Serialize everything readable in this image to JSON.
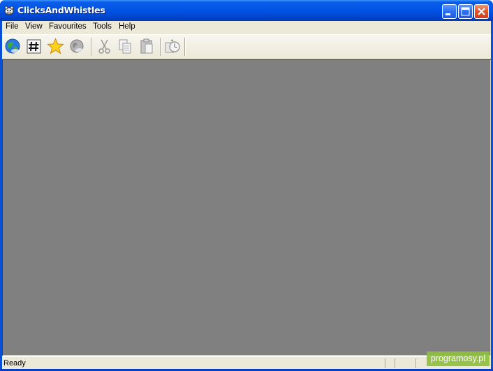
{
  "window": {
    "title": "ClicksAndWhistles",
    "icon": "hippo-app-icon",
    "controls": [
      "minimize-icon",
      "maximize-icon",
      "close-icon"
    ]
  },
  "menu": {
    "items": [
      {
        "label": "File"
      },
      {
        "label": "View"
      },
      {
        "label": "Favourites"
      },
      {
        "label": "Tools"
      },
      {
        "label": "Help"
      }
    ]
  },
  "toolbar": {
    "buttons": [
      {
        "icon": "globe-icon"
      },
      {
        "icon": "hash-icon"
      },
      {
        "icon": "star-icon"
      },
      {
        "icon": "globe-disabled-icon"
      },
      {
        "icon": "cut-icon"
      },
      {
        "icon": "copy-icon"
      },
      {
        "icon": "paste-icon"
      },
      {
        "icon": "history-icon"
      }
    ]
  },
  "status": {
    "text": "Ready"
  },
  "watermark": {
    "text": "programosy.pl"
  },
  "colors": {
    "titlebar": "#0055e5",
    "workspace": "#808080",
    "chrome": "#ece9d8",
    "watermark_bg": "#8fbf3f"
  }
}
